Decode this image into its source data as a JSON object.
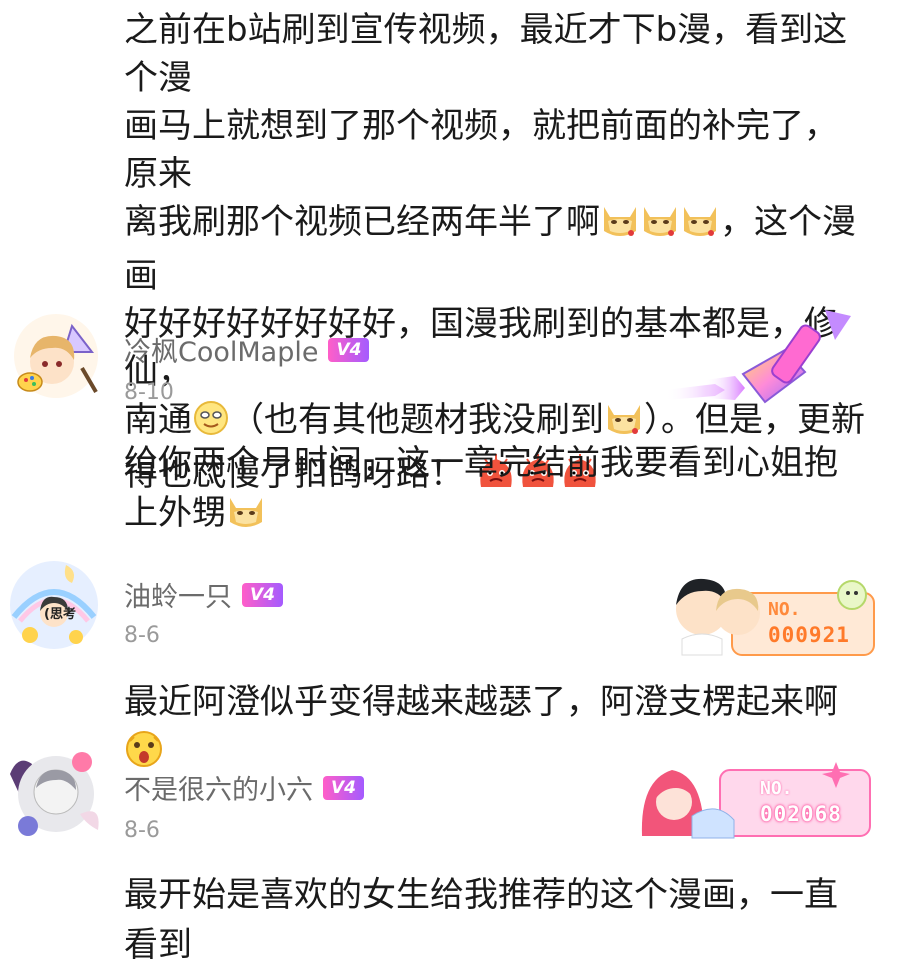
{
  "top_comment": {
    "line1": "之前在b站刷到宣传视频，最近才下b漫，看到这个漫",
    "line2": "画马上就想到了那个视频，就把前面的补完了，原来",
    "line3a": "离我刷那个视频已经两年半了啊",
    "line3b": "，这个漫画",
    "line4": "好好好好好好好好，国漫我刷到的基本都是，修仙，",
    "line5a": "南通",
    "line5b": "（也有其他题材我没刷到",
    "line5c": "）。但是，更新",
    "line6": "得也忒慢了扣鸽呀路！"
  },
  "comments": [
    {
      "username": "冷枫CoolMaple",
      "level": "V4",
      "date": "8-10",
      "text": "给你两个月时间，这一章完结前我要看到心姐抱上外甥"
    },
    {
      "username": "油蛉一只",
      "level": "V4",
      "date": "8-6",
      "avatar_text": "(思考",
      "badge_label": "NO.",
      "badge_number": "000921",
      "text": "最近阿澄似乎变得越来越瑟了，阿澄支楞起来啊"
    },
    {
      "username": "不是很六的小六",
      "level": "V4",
      "date": "8-6",
      "badge_label": "NO.",
      "badge_number": "002068",
      "text": "最开始是喜欢的女生给我推荐的这个漫画，一直看到"
    }
  ],
  "colors": {
    "level_badge_start": "#ff5ec8",
    "level_badge_end": "#a45bff",
    "badge_orange": "#ff8a3c",
    "badge_pink": "#ff5fa8"
  },
  "icons": [
    "doge-emoji",
    "smile-emoji",
    "angry-blob-emoji",
    "shocked-emoji",
    "paint-brush-decoration"
  ]
}
